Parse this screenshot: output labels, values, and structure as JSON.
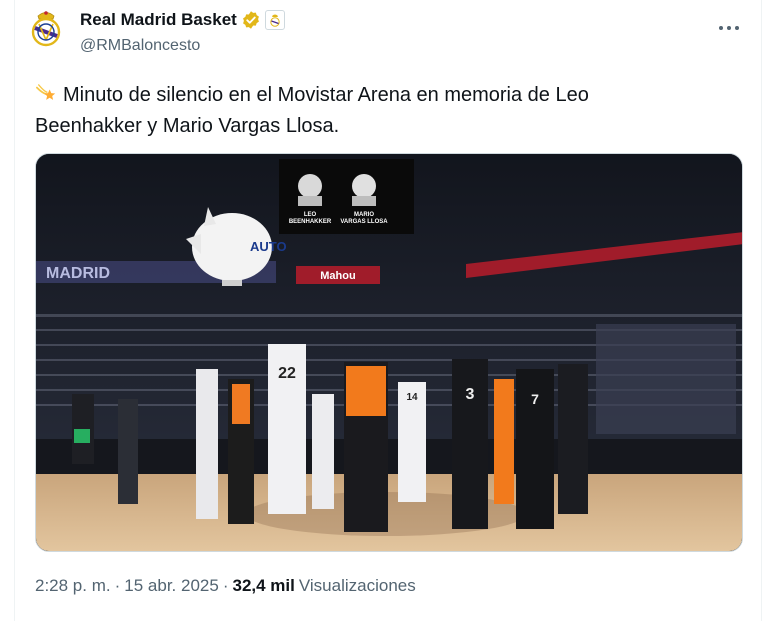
{
  "account": {
    "display_name": "Real Madrid Basket",
    "handle": "@RMBaloncesto",
    "verified": true
  },
  "tweet": {
    "emoji": "shooting-star-emoji",
    "text": "Minuto de silencio en el Movistar Arena en memoria de Leo Beenhakker y Mario Vargas Llosa."
  },
  "media": {
    "screen_labels": [
      "LEO\nBEENHAKKER",
      "MARIO\nVARGAS LLOSA"
    ],
    "screen_label_1a": "LEO",
    "screen_label_1b": "BEENHAKKER",
    "screen_label_2a": "MARIO",
    "screen_label_2b": "VARGAS LLOSA",
    "blimp_text": "AUTO",
    "arena_banner": "MADRID",
    "sponsor": "Mahou",
    "jersey_numbers": [
      "22",
      "3",
      "7",
      "14"
    ]
  },
  "meta": {
    "time": "2:28 p. m.",
    "separator": "·",
    "date": "15 abr. 2025",
    "views_count": "32,4 mil",
    "views_label": "Visualizaciones"
  },
  "colors": {
    "text": "#0f1419",
    "secondary": "#536471",
    "verified_gold": "#e2b719",
    "border": "#cfd9de"
  }
}
